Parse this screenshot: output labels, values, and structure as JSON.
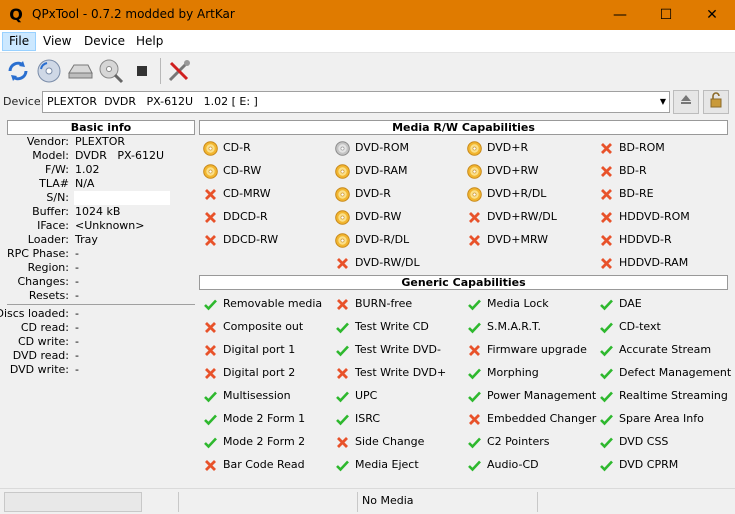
{
  "window": {
    "title": "QPxTool - 0.7.2 modded by ArtKar",
    "icon": "Q"
  },
  "controls": {
    "minimize": "—",
    "maximize": "☐",
    "close": "✕"
  },
  "menu": [
    {
      "label": "File"
    },
    {
      "label": "View"
    },
    {
      "label": "Device"
    },
    {
      "label": "Help"
    }
  ],
  "device_label": "Device:",
  "device_value": "PLEXTOR  DVDR   PX-612U   1.02 [ E: ]",
  "basic_info": {
    "title": "Basic info",
    "rows": [
      {
        "k": "Vendor:",
        "v": "PLEXTOR"
      },
      {
        "k": "Model:",
        "v": "DVDR   PX-612U"
      },
      {
        "k": "F/W:",
        "v": "1.02"
      },
      {
        "k": "TLA#",
        "v": "N/A"
      },
      {
        "k": "S/N:",
        "v": ""
      },
      {
        "k": "Buffer:",
        "v": "1024 kB"
      },
      {
        "k": "IFace:",
        "v": "<Unknown>"
      },
      {
        "k": "Loader:",
        "v": "Tray"
      },
      {
        "k": "RPC Phase:",
        "v": "-"
      },
      {
        "k": "Region:",
        "v": "-"
      },
      {
        "k": "Changes:",
        "v": "-"
      },
      {
        "k": "Resets:",
        "v": "-"
      }
    ],
    "rows2": [
      {
        "k": "Discs loaded:",
        "v": "-"
      },
      {
        "k": "CD read:",
        "v": "-"
      },
      {
        "k": "CD write:",
        "v": "-"
      },
      {
        "k": "DVD read:",
        "v": "-"
      },
      {
        "k": "DVD write:",
        "v": "-"
      }
    ]
  },
  "media_rw": {
    "title": "Media R/W Capabilities",
    "columns": [
      [
        {
          "l": "CD-R",
          "i": "rw"
        },
        {
          "l": "CD-RW",
          "i": "rw"
        },
        {
          "l": "CD-MRW",
          "i": "no"
        },
        {
          "l": "DDCD-R",
          "i": "no"
        },
        {
          "l": "DDCD-RW",
          "i": "no"
        }
      ],
      [
        {
          "l": "DVD-ROM",
          "i": "ro"
        },
        {
          "l": "DVD-RAM",
          "i": "rw"
        },
        {
          "l": "DVD-R",
          "i": "rw"
        },
        {
          "l": "DVD-RW",
          "i": "rw"
        },
        {
          "l": "DVD-R/DL",
          "i": "rw"
        },
        {
          "l": "DVD-RW/DL",
          "i": "no"
        }
      ],
      [
        {
          "l": "DVD+R",
          "i": "rw"
        },
        {
          "l": "DVD+RW",
          "i": "rw"
        },
        {
          "l": "DVD+R/DL",
          "i": "rw"
        },
        {
          "l": "DVD+RW/DL",
          "i": "no"
        },
        {
          "l": "DVD+MRW",
          "i": "no"
        }
      ],
      [
        {
          "l": "BD-ROM",
          "i": "no"
        },
        {
          "l": "BD-R",
          "i": "no"
        },
        {
          "l": "BD-RE",
          "i": "no"
        },
        {
          "l": "HDDVD-ROM",
          "i": "no"
        },
        {
          "l": "HDDVD-R",
          "i": "no"
        },
        {
          "l": "HDDVD-RAM",
          "i": "no"
        }
      ]
    ]
  },
  "generic": {
    "title": "Generic Capabilities",
    "columns": [
      [
        {
          "l": "Removable media",
          "i": "yes"
        },
        {
          "l": "Composite out",
          "i": "no"
        },
        {
          "l": "Digital port 1",
          "i": "no"
        },
        {
          "l": "Digital port 2",
          "i": "no"
        },
        {
          "l": "Multisession",
          "i": "yes"
        },
        {
          "l": "Mode 2 Form 1",
          "i": "yes"
        },
        {
          "l": "Mode 2 Form 2",
          "i": "yes"
        },
        {
          "l": "Bar Code Read",
          "i": "no"
        }
      ],
      [
        {
          "l": "BURN-free",
          "i": "no"
        },
        {
          "l": "Test Write CD",
          "i": "yes"
        },
        {
          "l": "Test Write DVD-",
          "i": "yes"
        },
        {
          "l": "Test Write DVD+",
          "i": "no"
        },
        {
          "l": "UPC",
          "i": "yes"
        },
        {
          "l": "ISRC",
          "i": "yes"
        },
        {
          "l": "Side Change",
          "i": "no"
        },
        {
          "l": "Media Eject",
          "i": "yes"
        }
      ],
      [
        {
          "l": "Media Lock",
          "i": "yes"
        },
        {
          "l": "S.M.A.R.T.",
          "i": "yes"
        },
        {
          "l": "Firmware upgrade",
          "i": "no"
        },
        {
          "l": "Morphing",
          "i": "yes"
        },
        {
          "l": "Power Management",
          "i": "yes"
        },
        {
          "l": "Embedded Changer",
          "i": "no"
        },
        {
          "l": "C2 Pointers",
          "i": "yes"
        },
        {
          "l": "Audio-CD",
          "i": "yes"
        }
      ],
      [
        {
          "l": "DAE",
          "i": "yes"
        },
        {
          "l": "CD-text",
          "i": "yes"
        },
        {
          "l": "Accurate Stream",
          "i": "yes"
        },
        {
          "l": "Defect Management",
          "i": "yes"
        },
        {
          "l": "Realtime Streaming",
          "i": "yes"
        },
        {
          "l": "Spare Area Info",
          "i": "yes"
        },
        {
          "l": "DVD CSS",
          "i": "yes"
        },
        {
          "l": "DVD CPRM",
          "i": "yes"
        }
      ]
    ]
  },
  "status": {
    "text": "No Media",
    "progress": 0
  },
  "colors": {
    "titlebar": "#e07b00",
    "check": "#2eb82e",
    "cross": "#e8522a",
    "disc": "#f2b630"
  }
}
